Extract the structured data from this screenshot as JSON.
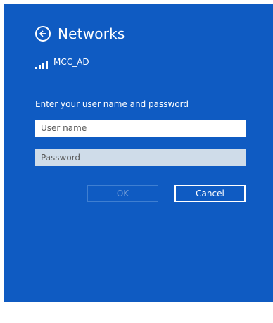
{
  "header": {
    "title": "Networks",
    "back_icon": "back-arrow-icon"
  },
  "network": {
    "name": "MCC_AD",
    "signal_icon": "signal-strength-icon"
  },
  "form": {
    "prompt": "Enter your user name and password",
    "username_placeholder": "User name",
    "username_value": "",
    "password_placeholder": "Password",
    "password_value": ""
  },
  "buttons": {
    "ok_label": "OK",
    "cancel_label": "Cancel"
  },
  "colors": {
    "background": "#0f5bc2",
    "text": "#ffffff",
    "password_field": "#cfdce9"
  }
}
